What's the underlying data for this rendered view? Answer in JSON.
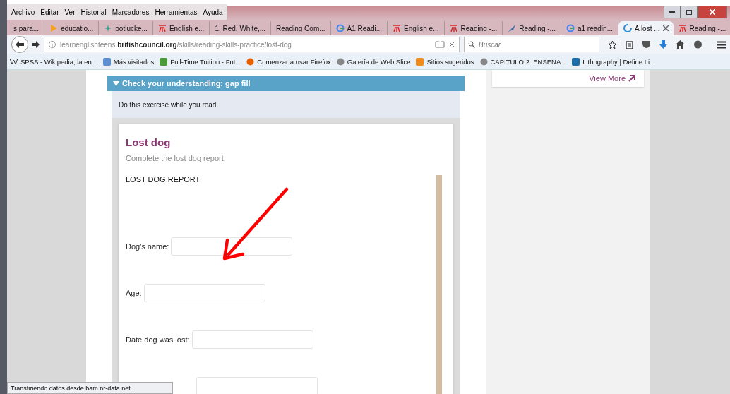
{
  "menu": [
    "Archivo",
    "Editar",
    "Ver",
    "Historial",
    "Marcadores",
    "Herramientas",
    "Ayuda"
  ],
  "tabs": [
    {
      "label": "s para...",
      "kind": "plain",
      "selected": false
    },
    {
      "label": "educatio...",
      "kind": "triangle",
      "selected": false
    },
    {
      "label": "potlucke...",
      "kind": "sparkle",
      "selected": false
    },
    {
      "label": "English e...",
      "kind": "glyph",
      "selected": false
    },
    {
      "label": "1. Red, White,...",
      "kind": "plain",
      "selected": false
    },
    {
      "label": "Reading Com...",
      "kind": "plain",
      "selected": false
    },
    {
      "label": "A1 Readi...",
      "kind": "g",
      "selected": false
    },
    {
      "label": "English e...",
      "kind": "glyph",
      "selected": false
    },
    {
      "label": "Reading -...",
      "kind": "glyph",
      "selected": false
    },
    {
      "label": "Reading -...",
      "kind": "feather",
      "selected": false
    },
    {
      "label": "a1 readin...",
      "kind": "g",
      "selected": false
    },
    {
      "label": "A lost ...",
      "kind": "spinner",
      "selected": true
    },
    {
      "label": "Reading -...",
      "kind": "glyph",
      "selected": false
    }
  ],
  "address": {
    "host_start": "learnenglishteens.",
    "host_bold": "britishcouncil.org",
    "path": "/skills/reading-skills-practice/lost-dog"
  },
  "search": {
    "placeholder": "Buscar"
  },
  "bookmarks": [
    {
      "label": "SPSS - Wikipedia, la en...",
      "kind": "w"
    },
    {
      "label": "Más visitados",
      "kind": "folder"
    },
    {
      "label": "Full-Time Tuition - Fut...",
      "kind": "leaf"
    },
    {
      "label": "Comenzar a usar Firefox",
      "kind": "firefox"
    },
    {
      "label": "Galería de Web Slice",
      "kind": "globe"
    },
    {
      "label": "Sitios sugeridos",
      "kind": "bulb"
    },
    {
      "label": "CAPITULO 2: ENSEÑA...",
      "kind": "globe"
    },
    {
      "label": "Lithography | Define Li...",
      "kind": "litho"
    }
  ],
  "section": {
    "title": "Check your understanding: gap fill",
    "expanded": true,
    "instruction": "Do this exercise while you read."
  },
  "exercise": {
    "title": "Lost dog",
    "subtitle": "Complete the lost dog report.",
    "heading": "LOST DOG REPORT",
    "fields": [
      {
        "kind": "labeled",
        "label": "Dog's name:"
      },
      {
        "kind": "labeled",
        "label": "Age:"
      },
      {
        "kind": "labeled",
        "label": "Date dog was lost:"
      },
      {
        "kind": "bare"
      }
    ]
  },
  "sidebar": {
    "link": "View More"
  },
  "status_bar": "Transfiriendo datos desde bam.nr-data.net..."
}
